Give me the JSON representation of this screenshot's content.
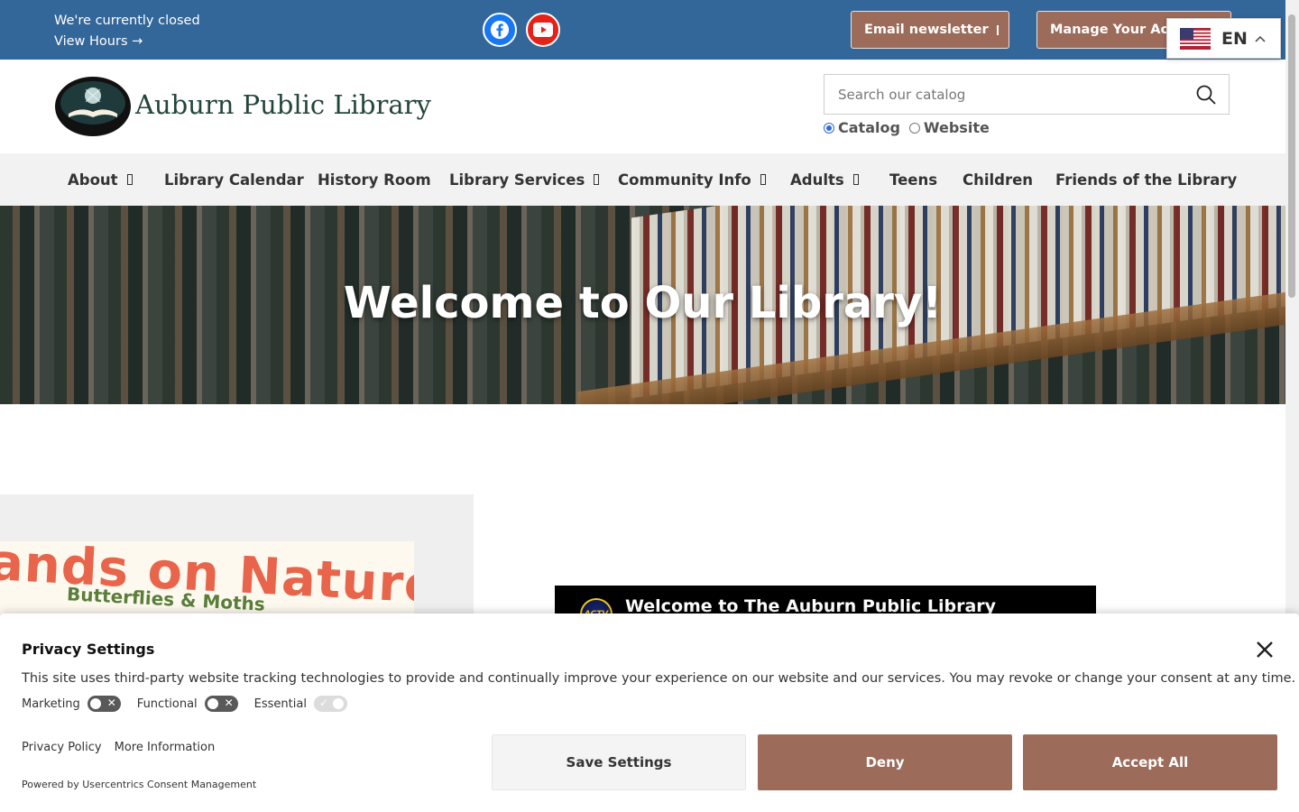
{
  "topbar": {
    "status_line": "We're currently closed",
    "hours_link": "View Hours →",
    "email_button": "Email newsletter",
    "account_button": "Manage Your Account",
    "language_code": "EN",
    "social": [
      "facebook-icon",
      "youtube-icon"
    ],
    "bg_color": "#336699",
    "button_color": "#9c6b5a"
  },
  "header": {
    "logo_text": "Auburn Public Library",
    "search_placeholder": "Search our catalog",
    "radio_options": [
      "Catalog",
      "Website"
    ],
    "radio_selected": "Catalog"
  },
  "nav": {
    "items": [
      {
        "label": "About",
        "dropdown": true
      },
      {
        "label": "Library Calendar",
        "dropdown": false
      },
      {
        "label": "History Room",
        "dropdown": false
      },
      {
        "label": "Library Services",
        "dropdown": true
      },
      {
        "label": "Community Info",
        "dropdown": true
      },
      {
        "label": "Adults",
        "dropdown": true
      },
      {
        "label": "Teens",
        "dropdown": false
      },
      {
        "label": "Children",
        "dropdown": false
      },
      {
        "label": "Friends of the Library",
        "dropdown": false
      }
    ]
  },
  "hero": {
    "title": "Welcome to Our Library!"
  },
  "feature": {
    "banner_line1": "ands on Nature",
    "banner_line2": "Butterflies & Moths"
  },
  "video": {
    "channel_badge": "ACTV",
    "title": "Welcome to The Auburn Public Library"
  },
  "privacy": {
    "title": "Privacy Settings",
    "body": "This site uses third-party website tracking technologies to provide and continually improve your experience on our website and our services. You may revoke or change your consent at any time.",
    "toggles": [
      {
        "label": "Marketing",
        "on": false,
        "disabled": false
      },
      {
        "label": "Functional",
        "on": false,
        "disabled": false
      },
      {
        "label": "Essential",
        "on": true,
        "disabled": true
      }
    ],
    "links": [
      "Privacy Policy",
      "More Information"
    ],
    "powered_by": "Powered by Usercentrics Consent Management",
    "save_button": "Save Settings",
    "deny_button": "Deny",
    "accept_button": "Accept All"
  }
}
